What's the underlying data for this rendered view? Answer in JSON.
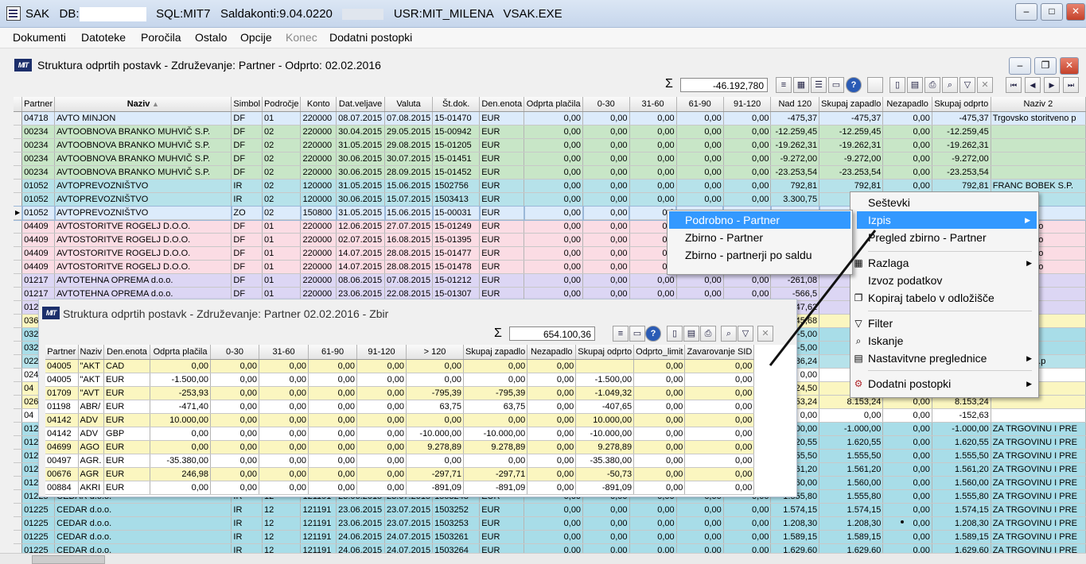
{
  "titlebar": {
    "app": "SAK",
    "db_label": "DB:",
    "sql": "SQL:MIT7",
    "saldakonti": "Saldakonti:9.04.0220",
    "user": "USR:MIT_MILENA",
    "exe": "VSAK.EXE"
  },
  "menubar": [
    "Dokumenti",
    "Datoteke",
    "Poročila",
    "Ostalo",
    "Opcije",
    "Konec",
    "Dodatni postopki"
  ],
  "main": {
    "title": "Struktura odprtih postavk  - Združevanje: Partner  - Odprto: 02.02.2016",
    "sum": "-46.192,780",
    "columns": [
      "Partner",
      "Naziv",
      "Simbol",
      "Področje",
      "Konto",
      "Dat.veljave",
      "Valuta",
      "Št.dok.",
      "Den.enota",
      "Odprta plačila",
      "0-30",
      "31-60",
      "61-90",
      "91-120",
      "Nad 120",
      "Skupaj zapadlo",
      "Nezapadlo",
      "Skupaj odprto",
      "Naziv 2"
    ],
    "rows": [
      {
        "c": "r-blue",
        "v": [
          "04718",
          "AVTO MINJON",
          "DF",
          "01",
          "220000",
          "08.07.2015",
          "07.08.2015",
          "15-01470",
          "EUR",
          "0,00",
          "0,00",
          "0,00",
          "0,00",
          "0,00",
          "-475,37",
          "-475,37",
          "0,00",
          "-475,37",
          "Trgovsko storitveno p"
        ]
      },
      {
        "c": "r-green",
        "v": [
          "00234",
          "AVTOOBNOVA BRANKO MUHVIČ S.P.",
          "DF",
          "02",
          "220000",
          "30.04.2015",
          "29.05.2015",
          "15-00942",
          "EUR",
          "0,00",
          "0,00",
          "0,00",
          "0,00",
          "0,00",
          "-12.259,45",
          "-12.259,45",
          "0,00",
          "-12.259,45",
          ""
        ]
      },
      {
        "c": "r-green",
        "v": [
          "00234",
          "AVTOOBNOVA BRANKO MUHVIČ S.P.",
          "DF",
          "02",
          "220000",
          "31.05.2015",
          "29.08.2015",
          "15-01205",
          "EUR",
          "0,00",
          "0,00",
          "0,00",
          "0,00",
          "0,00",
          "-19.262,31",
          "-19.262,31",
          "0,00",
          "-19.262,31",
          ""
        ]
      },
      {
        "c": "r-green",
        "v": [
          "00234",
          "AVTOOBNOVA BRANKO MUHVIČ S.P.",
          "DF",
          "02",
          "220000",
          "30.06.2015",
          "30.07.2015",
          "15-01451",
          "EUR",
          "0,00",
          "0,00",
          "0,00",
          "0,00",
          "0,00",
          "-9.272,00",
          "-9.272,00",
          "0,00",
          "-9.272,00",
          ""
        ]
      },
      {
        "c": "r-green",
        "v": [
          "00234",
          "AVTOOBNOVA BRANKO MUHVIČ S.P.",
          "DF",
          "02",
          "220000",
          "30.06.2015",
          "28.09.2015",
          "15-01452",
          "EUR",
          "0,00",
          "0,00",
          "0,00",
          "0,00",
          "0,00",
          "-23.253,54",
          "-23.253,54",
          "0,00",
          "-23.253,54",
          ""
        ]
      },
      {
        "c": "r-teal",
        "v": [
          "01052",
          "AVTOPREVOZNIŠTVO",
          "IR",
          "02",
          "120000",
          "31.05.2015",
          "15.06.2015",
          "1502756",
          "EUR",
          "0,00",
          "0,00",
          "0,00",
          "0,00",
          "0,00",
          "792,81",
          "792,81",
          "0,00",
          "792,81",
          "FRANC BOBEK S.P."
        ]
      },
      {
        "c": "r-teal",
        "v": [
          "01052",
          "AVTOPREVOZNIŠTVO",
          "IR",
          "02",
          "120000",
          "30.06.2015",
          "15.07.2015",
          "1503413",
          "EUR",
          "0,00",
          "0,00",
          "0,00",
          "0,00",
          "0,00",
          "3.300,75",
          "",
          "",
          "",
          "OBEK S.P."
        ]
      },
      {
        "c": "r-blue",
        "sel": true,
        "v": [
          "01052",
          "AVTOPREVOZNIŠTVO",
          "ZO",
          "02",
          "150800",
          "31.05.2015",
          "15.06.2015",
          "15-00031",
          "EUR",
          "0,00",
          "0,00",
          "0,0",
          "",
          "",
          "",
          "",
          "",
          "",
          "OBEK S.P."
        ]
      },
      {
        "c": "r-pink",
        "v": [
          "04409",
          "AVTOSTORITVE ROGELJ D.O.O.",
          "DF",
          "01",
          "220000",
          "12.06.2015",
          "27.07.2015",
          "15-01249",
          "EUR",
          "0,00",
          "0,00",
          "0,0",
          "",
          "",
          "",
          "",
          "",
          "",
          "arstvo in trgo"
        ]
      },
      {
        "c": "r-pink",
        "v": [
          "04409",
          "AVTOSTORITVE ROGELJ D.O.O.",
          "DF",
          "01",
          "220000",
          "02.07.2015",
          "16.08.2015",
          "15-01395",
          "EUR",
          "0,00",
          "0,00",
          "0,0",
          "",
          "",
          "",
          "",
          "",
          "",
          "arstvo in trgo"
        ]
      },
      {
        "c": "r-pink",
        "v": [
          "04409",
          "AVTOSTORITVE ROGELJ D.O.O.",
          "DF",
          "01",
          "220000",
          "14.07.2015",
          "28.08.2015",
          "15-01477",
          "EUR",
          "0,00",
          "0,00",
          "0,0",
          "",
          "",
          "",
          "",
          "",
          "",
          "arstvo in trgo"
        ]
      },
      {
        "c": "r-pink",
        "v": [
          "04409",
          "AVTOSTORITVE ROGELJ D.O.O.",
          "DF",
          "01",
          "220000",
          "14.07.2015",
          "28.08.2015",
          "15-01478",
          "EUR",
          "0,00",
          "0,00",
          "0,0",
          "",
          "",
          "",
          "",
          "",
          "",
          "arstvo in trgo"
        ]
      },
      {
        "c": "r-lav",
        "v": [
          "01217",
          "AVTOTEHNA OPREMA d.o.o.",
          "DF",
          "01",
          "220000",
          "08.06.2015",
          "07.08.2015",
          "15-01212",
          "EUR",
          "0,00",
          "0,00",
          "0,00",
          "0,00",
          "0,00",
          "-261,08",
          "",
          "",
          "",
          ""
        ]
      },
      {
        "c": "r-lav",
        "v": [
          "01217",
          "AVTOTEHNA OPREMA d.o.o.",
          "DF",
          "01",
          "220000",
          "23.06.2015",
          "22.08.2015",
          "15-01307",
          "EUR",
          "0,00",
          "0,00",
          "0,00",
          "0,00",
          "0,00",
          "-566,5",
          "",
          "",
          "",
          ""
        ]
      },
      {
        "c": "r-lav",
        "v": [
          "012",
          "",
          "",
          "",
          "",
          "",
          "",
          "",
          "",
          "",
          "",
          "",
          "",
          "",
          "-747,62",
          "",
          "",
          "",
          ""
        ]
      },
      {
        "c": "r-yel",
        "v": [
          "036",
          "",
          "",
          "",
          "",
          "",
          "",
          "",
          "",
          "",
          "",
          "",
          "",
          "",
          "45,68",
          "",
          "",
          "",
          ""
        ]
      },
      {
        "c": "r-cyan",
        "v": [
          "032",
          "",
          "",
          "",
          "",
          "",
          "",
          "",
          "",
          "",
          "",
          "",
          "",
          "",
          "-5,00",
          "",
          "",
          "",
          "ZA MEDIJE"
        ]
      },
      {
        "c": "r-cyan",
        "v": [
          "032",
          "",
          "",
          "",
          "",
          "",
          "",
          "",
          "",
          "",
          "",
          "",
          "",
          "",
          "-5,00",
          "",
          "",
          "",
          "ZA MEDIJE"
        ]
      },
      {
        "c": "r-teal",
        "v": [
          "022",
          "",
          "",
          "",
          "",
          "",
          "",
          "",
          "",
          "",
          "",
          "",
          "",
          "",
          "-786,24",
          "",
          "",
          "",
          "KERSNIČ s.p"
        ]
      },
      {
        "c": "r-wht",
        "v": [
          "024",
          "",
          "",
          "",
          "",
          "",
          "",
          "",
          "",
          "",
          "",
          "",
          "",
          "",
          "0,00",
          "",
          "",
          "",
          ""
        ]
      },
      {
        "c": "r-yel",
        "v": [
          "04",
          "",
          "",
          "",
          "",
          "",
          "",
          "",
          "",
          "",
          "",
          "",
          "",
          "",
          "3.224,50",
          "",
          "",
          "",
          ""
        ]
      },
      {
        "c": "r-yel",
        "v": [
          "026",
          "",
          "",
          "",
          "",
          "",
          "",
          "",
          "",
          "",
          "",
          "",
          "",
          "",
          "8.153,24",
          "8.153,24",
          "0,00",
          "8.153,24",
          ""
        ]
      },
      {
        "c": "r-wht",
        "v": [
          "04",
          "",
          "",
          "",
          "",
          "",
          "",
          "",
          "",
          "",
          "",
          "",
          "",
          "",
          "0,00",
          "0,00",
          "0,00",
          "-152,63",
          ""
        ]
      },
      {
        "c": "r-cyan",
        "v": [
          "012",
          "",
          "",
          "",
          "",
          "",
          "",
          "",
          "",
          "",
          "",
          "",
          "",
          "",
          "-1.000,00",
          "-1.000,00",
          "0,00",
          "-1.000,00",
          "ZA TRGOVINU I PRE"
        ]
      },
      {
        "c": "r-cyan",
        "v": [
          "012",
          "",
          "",
          "",
          "",
          "",
          "",
          "",
          "",
          "",
          "",
          "",
          "",
          "",
          "1.620,55",
          "1.620,55",
          "0,00",
          "1.620,55",
          "ZA TRGOVINU I PRE"
        ]
      },
      {
        "c": "r-cyan",
        "v": [
          "012",
          "",
          "",
          "",
          "",
          "",
          "",
          "",
          "",
          "",
          "",
          "",
          "",
          "",
          "1.555,50",
          "1.555,50",
          "0,00",
          "1.555,50",
          "ZA TRGOVINU I PRE"
        ]
      },
      {
        "c": "r-cyan",
        "v": [
          "012",
          "",
          "",
          "",
          "",
          "",
          "",
          "",
          "",
          "",
          "",
          "",
          "",
          "",
          "1.561,20",
          "1.561,20",
          "0,00",
          "1.561,20",
          "ZA TRGOVINU I PRE"
        ]
      },
      {
        "c": "r-cyan",
        "v": [
          "012",
          "",
          "",
          "",
          "",
          "",
          "",
          "",
          "",
          "",
          "",
          "",
          "",
          "",
          "1.560,00",
          "1.560,00",
          "0,00",
          "1.560,00",
          "ZA TRGOVINU I PRE"
        ]
      },
      {
        "c": "r-cyan",
        "v": [
          "01225",
          "CEDAR d.o.o.",
          "IR",
          "12",
          "121191",
          "23.06.2015",
          "23.07.2015",
          "1503248",
          "EUR",
          "0,00",
          "0,00",
          "0,00",
          "0,00",
          "0,00",
          "1.555,80",
          "1.555,80",
          "0,00",
          "1.555,80",
          "ZA TRGOVINU I PRE"
        ]
      },
      {
        "c": "r-cyan",
        "v": [
          "01225",
          "CEDAR d.o.o.",
          "IR",
          "12",
          "121191",
          "23.06.2015",
          "23.07.2015",
          "1503252",
          "EUR",
          "0,00",
          "0,00",
          "0,00",
          "0,00",
          "0,00",
          "1.574,15",
          "1.574,15",
          "0,00",
          "1.574,15",
          "ZA TRGOVINU I PRE"
        ]
      },
      {
        "c": "r-cyan",
        "v": [
          "01225",
          "CEDAR d.o.o.",
          "IR",
          "12",
          "121191",
          "23.06.2015",
          "23.07.2015",
          "1503253",
          "EUR",
          "0,00",
          "0,00",
          "0,00",
          "0,00",
          "0,00",
          "1.208,30",
          "1.208,30",
          "0,00",
          "1.208,30",
          "ZA TRGOVINU I PRE"
        ]
      },
      {
        "c": "r-cyan",
        "v": [
          "01225",
          "CEDAR d.o.o.",
          "IR",
          "12",
          "121191",
          "24.06.2015",
          "24.07.2015",
          "1503261",
          "EUR",
          "0,00",
          "0,00",
          "0,00",
          "0,00",
          "0,00",
          "1.589,15",
          "1.589,15",
          "0,00",
          "1.589,15",
          "ZA TRGOVINU I PRE"
        ]
      },
      {
        "c": "r-cyan",
        "v": [
          "01225",
          "CEDAR d.o.o.",
          "IR",
          "12",
          "121191",
          "24.06.2015",
          "24.07.2015",
          "1503264",
          "EUR",
          "0,00",
          "0,00",
          "0,00",
          "0,00",
          "0,00",
          "1.629,60",
          "1.629,60",
          "0,00",
          "1.629,60",
          "ZA TRGOVINU I PRE"
        ]
      }
    ]
  },
  "zbir": {
    "title": "Struktura odprtih postavk  - Združevanje: Partner  02.02.2016  - Zbir",
    "sum": "654.100,36",
    "columns": [
      "Partner",
      "Naziv",
      "Den.enota",
      "Odprta plačila",
      "0-30",
      "31-60",
      "61-90",
      "91-120",
      "> 120",
      "Skupaj zapadlo",
      "Nezapadlo",
      "Skupaj odprto",
      "Odprto_limit",
      "Zavarovanje SID"
    ],
    "rows": [
      {
        "c": "r-yel",
        "v": [
          "04005",
          "\"AKT",
          "CAD",
          "0,00",
          "0,00",
          "0,00",
          "0,00",
          "0,00",
          "0,00",
          "0,00",
          "0,00",
          "",
          "0,00",
          "0,00"
        ]
      },
      {
        "c": "r-wht",
        "v": [
          "04005",
          "\"AKT",
          "EUR",
          "-1.500,00",
          "0,00",
          "0,00",
          "0,00",
          "0,00",
          "0,00",
          "0,00",
          "0,00",
          "-1.500,00",
          "0,00",
          "0,00"
        ]
      },
      {
        "c": "r-yel",
        "v": [
          "01709",
          "\"AVT",
          "EUR",
          "-253,93",
          "0,00",
          "0,00",
          "0,00",
          "0,00",
          "-795,39",
          "-795,39",
          "0,00",
          "-1.049,32",
          "0,00",
          "0,00"
        ]
      },
      {
        "c": "r-wht",
        "v": [
          "01198",
          "ABR/",
          "EUR",
          "-471,40",
          "0,00",
          "0,00",
          "0,00",
          "0,00",
          "63,75",
          "63,75",
          "0,00",
          "-407,65",
          "0,00",
          "0,00"
        ]
      },
      {
        "c": "r-yel",
        "v": [
          "04142",
          "ADV",
          "EUR",
          "10.000,00",
          "0,00",
          "0,00",
          "0,00",
          "0,00",
          "0,00",
          "0,00",
          "0,00",
          "10.000,00",
          "0,00",
          "0,00"
        ]
      },
      {
        "c": "r-wht",
        "v": [
          "04142",
          "ADV",
          "GBP",
          "0,00",
          "0,00",
          "0,00",
          "0,00",
          "0,00",
          "-10.000,00",
          "-10.000,00",
          "0,00",
          "-10.000,00",
          "0,00",
          "0,00"
        ]
      },
      {
        "c": "r-yel",
        "v": [
          "04699",
          "AGO",
          "EUR",
          "0,00",
          "0,00",
          "0,00",
          "0,00",
          "0,00",
          "9.278,89",
          "9.278,89",
          "0,00",
          "9.278,89",
          "0,00",
          "0,00"
        ]
      },
      {
        "c": "r-wht",
        "v": [
          "00497",
          "AGR.",
          "EUR",
          "-35.380,00",
          "0,00",
          "0,00",
          "0,00",
          "0,00",
          "0,00",
          "0,00",
          "0,00",
          "-35.380,00",
          "0,00",
          "0,00"
        ]
      },
      {
        "c": "r-yel",
        "v": [
          "00676",
          "AGR",
          "EUR",
          "246,98",
          "0,00",
          "0,00",
          "0,00",
          "0,00",
          "-297,71",
          "-297,71",
          "0,00",
          "-50,73",
          "0,00",
          "0,00"
        ]
      },
      {
        "c": "r-wht",
        "v": [
          "00884",
          "AKRI",
          "EUR",
          "0,00",
          "0,00",
          "0,00",
          "0,00",
          "0,00",
          "-891,09",
          "-891,09",
          "0,00",
          "-891,09",
          "0,00",
          "0,00"
        ]
      }
    ]
  },
  "context_menu": {
    "items": [
      "Seštevki",
      "Izpis",
      "Pregled zbirno - Partner",
      "Razlaga",
      "Izvoz podatkov",
      "Kopiraj tabelo v odložišče",
      "Filter",
      "Iskanje",
      "Nastavitvne preglednice",
      "Dodatni postopki"
    ]
  },
  "submenu": {
    "items": [
      "Podrobno - Partner",
      "Zbirno - Partner",
      "Zbirno - partnerji po saldu"
    ]
  },
  "colors": {
    "highlight": "#3399ff",
    "zbir_row": "#fbf6c0",
    "green_row": "#c8e6c7",
    "cyan_row": "#a8dde8"
  }
}
